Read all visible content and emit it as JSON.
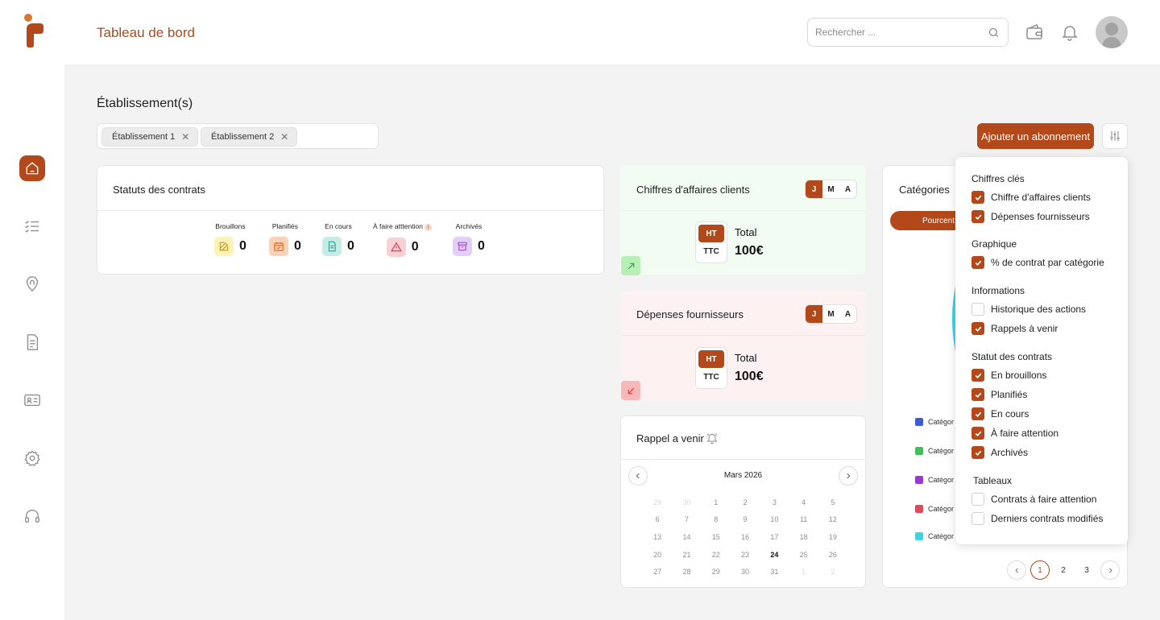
{
  "header": {
    "title": "Tableau de bord",
    "search_placeholder": "Rechercher ..."
  },
  "sidebar": {
    "items": [
      "home-icon",
      "checklist-icon",
      "location-pin-icon",
      "document-icon",
      "id-card-icon",
      "gear-icon",
      "headset-icon"
    ],
    "active": "home-icon"
  },
  "establishments": {
    "title": "Établissement(s)",
    "chips": [
      "Établissement 1",
      "Établissement 2"
    ]
  },
  "actions": {
    "add_subscription": "Ajouter un abonnement"
  },
  "contract_status": {
    "title": "Statuts des contrats",
    "items": [
      {
        "label": "Brouillons",
        "count": "0"
      },
      {
        "label": "Planifiés",
        "count": "0"
      },
      {
        "label": "En cours",
        "count": "0"
      },
      {
        "label": "À faire atttention",
        "count": "0"
      },
      {
        "label": "Archivés",
        "count": "0"
      }
    ]
  },
  "revenue": {
    "title": "Chiffres d'affaires clients",
    "periods": [
      "J",
      "M",
      "A"
    ],
    "selected_period": "J",
    "ht": "HT",
    "ttc": "TTC",
    "total_label": "Total",
    "total_value": "100€"
  },
  "expenses": {
    "title": "Dépenses fournisseurs",
    "periods": [
      "J",
      "M",
      "A"
    ],
    "selected_period": "J",
    "ht": "HT",
    "ttc": "TTC",
    "total_label": "Total",
    "total_value": "100€"
  },
  "reminders": {
    "title": "Rappel a venir",
    "month": "Mars 2026",
    "today": "24",
    "days": [
      {
        "d": "29",
        "m": true
      },
      {
        "d": "30",
        "m": true
      },
      {
        "d": "1"
      },
      {
        "d": "2"
      },
      {
        "d": "3"
      },
      {
        "d": "4"
      },
      {
        "d": "5"
      },
      {
        "d": "6"
      },
      {
        "d": "7"
      },
      {
        "d": "8"
      },
      {
        "d": "9"
      },
      {
        "d": "10"
      },
      {
        "d": "11"
      },
      {
        "d": "12"
      },
      {
        "d": "13"
      },
      {
        "d": "14"
      },
      {
        "d": "15"
      },
      {
        "d": "16"
      },
      {
        "d": "17"
      },
      {
        "d": "18"
      },
      {
        "d": "19"
      },
      {
        "d": "20"
      },
      {
        "d": "21"
      },
      {
        "d": "22"
      },
      {
        "d": "23"
      },
      {
        "d": "24"
      },
      {
        "d": "25"
      },
      {
        "d": "26"
      },
      {
        "d": "27"
      },
      {
        "d": "28"
      },
      {
        "d": "29"
      },
      {
        "d": "30"
      },
      {
        "d": "31"
      },
      {
        "d": "1",
        "m": true
      },
      {
        "d": "2",
        "m": true
      }
    ]
  },
  "categories": {
    "title": "Catégories",
    "tab": "Pourcent",
    "legend": [
      {
        "label": "Catégor",
        "color": "#3b5bdb"
      },
      {
        "label": "Catégor",
        "color": "#40c057"
      },
      {
        "label": "Catégor",
        "color": "#9c36d9"
      },
      {
        "label": "Catégor",
        "color": "#e0495b"
      },
      {
        "label": "Catégor",
        "color": "#3bd5e6"
      }
    ],
    "pages": [
      "1",
      "2",
      "3"
    ],
    "current_page": "1"
  },
  "widget_menu": {
    "groups": [
      {
        "title": "Chiffres clés",
        "items": [
          {
            "label": "Chiffre d'affaires clients",
            "checked": true
          },
          {
            "label": "Dépenses fournisseurs",
            "checked": true
          }
        ]
      },
      {
        "title": "Graphique",
        "items": [
          {
            "label": "% de contrat par catégorie",
            "checked": true
          }
        ]
      },
      {
        "title": "Informations",
        "items": [
          {
            "label": "Historique des actions",
            "checked": false
          },
          {
            "label": "Rappels à venir",
            "checked": true
          }
        ]
      },
      {
        "title": "Statut des contrats",
        "items": [
          {
            "label": "En brouillons",
            "checked": true
          },
          {
            "label": "Planifiés",
            "checked": true
          },
          {
            "label": "En cours",
            "checked": true
          },
          {
            "label": "À faire attention",
            "checked": true
          },
          {
            "label": "Archivés",
            "checked": true
          }
        ]
      },
      {
        "title": "Tableaux",
        "items": [
          {
            "label": "Contrats à faire attention",
            "checked": false
          },
          {
            "label": "Derniers contrats modifiés",
            "checked": false
          }
        ]
      }
    ]
  },
  "colors": {
    "accent": "#b3491a",
    "revenue_bg": "#f2fcf2",
    "expenses_bg": "#fdf1f1"
  }
}
